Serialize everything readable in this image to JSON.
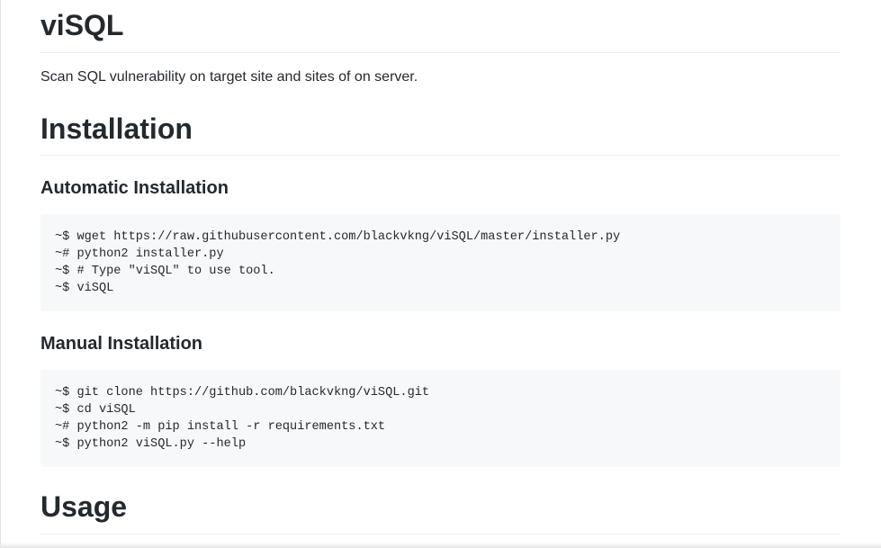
{
  "title": "viSQL",
  "description": "Scan SQL vulnerability on target site and sites of on server.",
  "installation": {
    "heading": "Installation",
    "automatic": {
      "heading": "Automatic Installation",
      "lines": [
        "~$ wget https://raw.githubusercontent.com/blackvkng/viSQL/master/installer.py",
        "~# python2 installer.py",
        "~$ # Type \"viSQL\" to use tool.",
        "~$ viSQL"
      ]
    },
    "manual": {
      "heading": "Manual Installation",
      "lines": [
        "~$ git clone https://github.com/blackvkng/viSQL.git",
        "~$ cd viSQL",
        "~# python2 -m pip install -r requirements.txt",
        "~$ python2 viSQL.py --help"
      ]
    }
  },
  "usage": {
    "heading": "Usage"
  }
}
